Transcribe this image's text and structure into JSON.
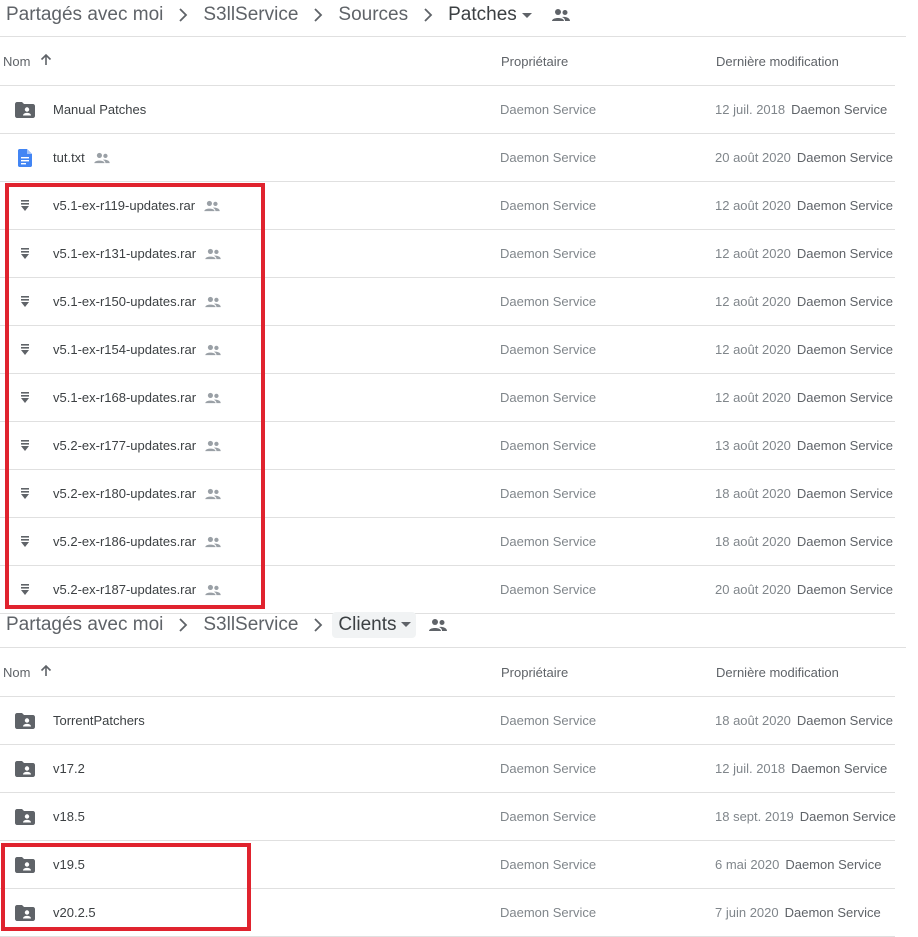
{
  "top": {
    "breadcrumb": [
      "Partagés avec moi",
      "S3llService",
      "Sources",
      "Patches"
    ],
    "columns": {
      "name": "Nom",
      "owner": "Propriétaire",
      "modified": "Dernière modification"
    },
    "rows": [
      {
        "icon": "shared-folder",
        "name": "Manual Patches",
        "shared": false,
        "owner": "Daemon Service",
        "date": "12 juil. 2018",
        "by": "Daemon Service"
      },
      {
        "icon": "doc",
        "name": "tut.txt",
        "shared": true,
        "owner": "Daemon Service",
        "date": "20 août 2020",
        "by": "Daemon Service"
      },
      {
        "icon": "archive",
        "name": "v5.1-ex-r119-updates.rar",
        "shared": true,
        "owner": "Daemon Service",
        "date": "12 août 2020",
        "by": "Daemon Service"
      },
      {
        "icon": "archive",
        "name": "v5.1-ex-r131-updates.rar",
        "shared": true,
        "owner": "Daemon Service",
        "date": "12 août 2020",
        "by": "Daemon Service"
      },
      {
        "icon": "archive",
        "name": "v5.1-ex-r150-updates.rar",
        "shared": true,
        "owner": "Daemon Service",
        "date": "12 août 2020",
        "by": "Daemon Service"
      },
      {
        "icon": "archive",
        "name": "v5.1-ex-r154-updates.rar",
        "shared": true,
        "owner": "Daemon Service",
        "date": "12 août 2020",
        "by": "Daemon Service"
      },
      {
        "icon": "archive",
        "name": "v5.1-ex-r168-updates.rar",
        "shared": true,
        "owner": "Daemon Service",
        "date": "12 août 2020",
        "by": "Daemon Service"
      },
      {
        "icon": "archive",
        "name": "v5.2-ex-r177-updates.rar",
        "shared": true,
        "owner": "Daemon Service",
        "date": "13 août 2020",
        "by": "Daemon Service"
      },
      {
        "icon": "archive",
        "name": "v5.2-ex-r180-updates.rar",
        "shared": true,
        "owner": "Daemon Service",
        "date": "18 août 2020",
        "by": "Daemon Service"
      },
      {
        "icon": "archive",
        "name": "v5.2-ex-r186-updates.rar",
        "shared": true,
        "owner": "Daemon Service",
        "date": "18 août 2020",
        "by": "Daemon Service"
      },
      {
        "icon": "archive",
        "name": "v5.2-ex-r187-updates.rar",
        "shared": true,
        "owner": "Daemon Service",
        "date": "20 août 2020",
        "by": "Daemon Service"
      }
    ]
  },
  "bottom": {
    "breadcrumb": [
      "Partagés avec moi",
      "S3llService",
      "Clients"
    ],
    "columns": {
      "name": "Nom",
      "owner": "Propriétaire",
      "modified": "Dernière modification"
    },
    "rows": [
      {
        "icon": "shared-folder",
        "name": "TorrentPatchers",
        "shared": false,
        "owner": "Daemon Service",
        "date": "18 août 2020",
        "by": "Daemon Service"
      },
      {
        "icon": "shared-folder",
        "name": "v17.2",
        "shared": false,
        "owner": "Daemon Service",
        "date": "12 juil. 2018",
        "by": "Daemon Service"
      },
      {
        "icon": "shared-folder",
        "name": "v18.5",
        "shared": false,
        "owner": "Daemon Service",
        "date": "18 sept. 2019",
        "by": "Daemon Service"
      },
      {
        "icon": "shared-folder",
        "name": "v19.5",
        "shared": false,
        "owner": "Daemon Service",
        "date": "6 mai 2020",
        "by": "Daemon Service"
      },
      {
        "icon": "shared-folder",
        "name": "v20.2.5",
        "shared": false,
        "owner": "Daemon Service",
        "date": "7 juin 2020",
        "by": "Daemon Service"
      }
    ]
  },
  "colors": {
    "accent_box": "#e0232e",
    "doc_icon": "#4285f4",
    "folder_icon": "#5f6368"
  }
}
